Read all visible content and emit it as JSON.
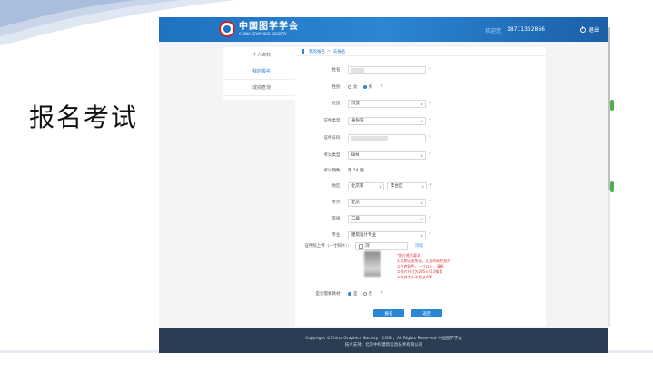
{
  "slide": {
    "title": "报名考试"
  },
  "site": {
    "logo_cn": "中国图学学会",
    "logo_en": "CHINA GRAPHICS SOCIETY",
    "welcome": "欢迎您",
    "phone": "18711352866",
    "logout": "退出"
  },
  "sidebar": {
    "items": [
      {
        "label": "个人资料",
        "active": false
      },
      {
        "label": "我的报名",
        "active": true
      },
      {
        "label": "成绩查询",
        "active": false
      }
    ]
  },
  "breadcrumb": {
    "parent": "我的报名",
    "current": "去报名"
  },
  "form": {
    "name": {
      "label": "姓名："
    },
    "gender": {
      "label": "性别：",
      "options": [
        "女",
        "男"
      ],
      "selected": "男"
    },
    "ethnicity": {
      "label": "民族：",
      "value": "汉族"
    },
    "id_type": {
      "label": "证件类型：",
      "value": "身份证"
    },
    "id_number": {
      "label": "证件号码："
    },
    "exam_type": {
      "label": "考试类型：",
      "value": "BIM"
    },
    "exam_session": {
      "label": "考试期数：",
      "value": "第 14 期"
    },
    "region": {
      "label": "地区：",
      "province": "北京市",
      "district": "丰台区"
    },
    "exam_site": {
      "label": "考点：",
      "value": "北京"
    },
    "level": {
      "label": "等级：",
      "value": "二级"
    },
    "major": {
      "label": "专业：",
      "value": "建筑设计专业"
    },
    "upload": {
      "label": "证件照上传（一寸照片）：",
      "file_text": "浏",
      "browse": "浏览"
    },
    "photo_notes": [
      "*照片格式要求：",
      "①近期正面免冠，正面的彩色照片",
      "②白底彩色，一寸以上，清晰",
      "③照片尺寸为295×413像素",
      "④文件大小不超过40K"
    ],
    "need_textbook": {
      "label": "是否需要教材：",
      "options": [
        "是",
        "否"
      ],
      "selected": "是"
    },
    "submit": "报名",
    "cancel": "返回"
  },
  "footer": {
    "line1": "Copyright ©China Graphics Society（CGS），All Rights Reserved 中国图学学会",
    "line2": "技术支持：北京中科建筑信息技术有限公司"
  }
}
